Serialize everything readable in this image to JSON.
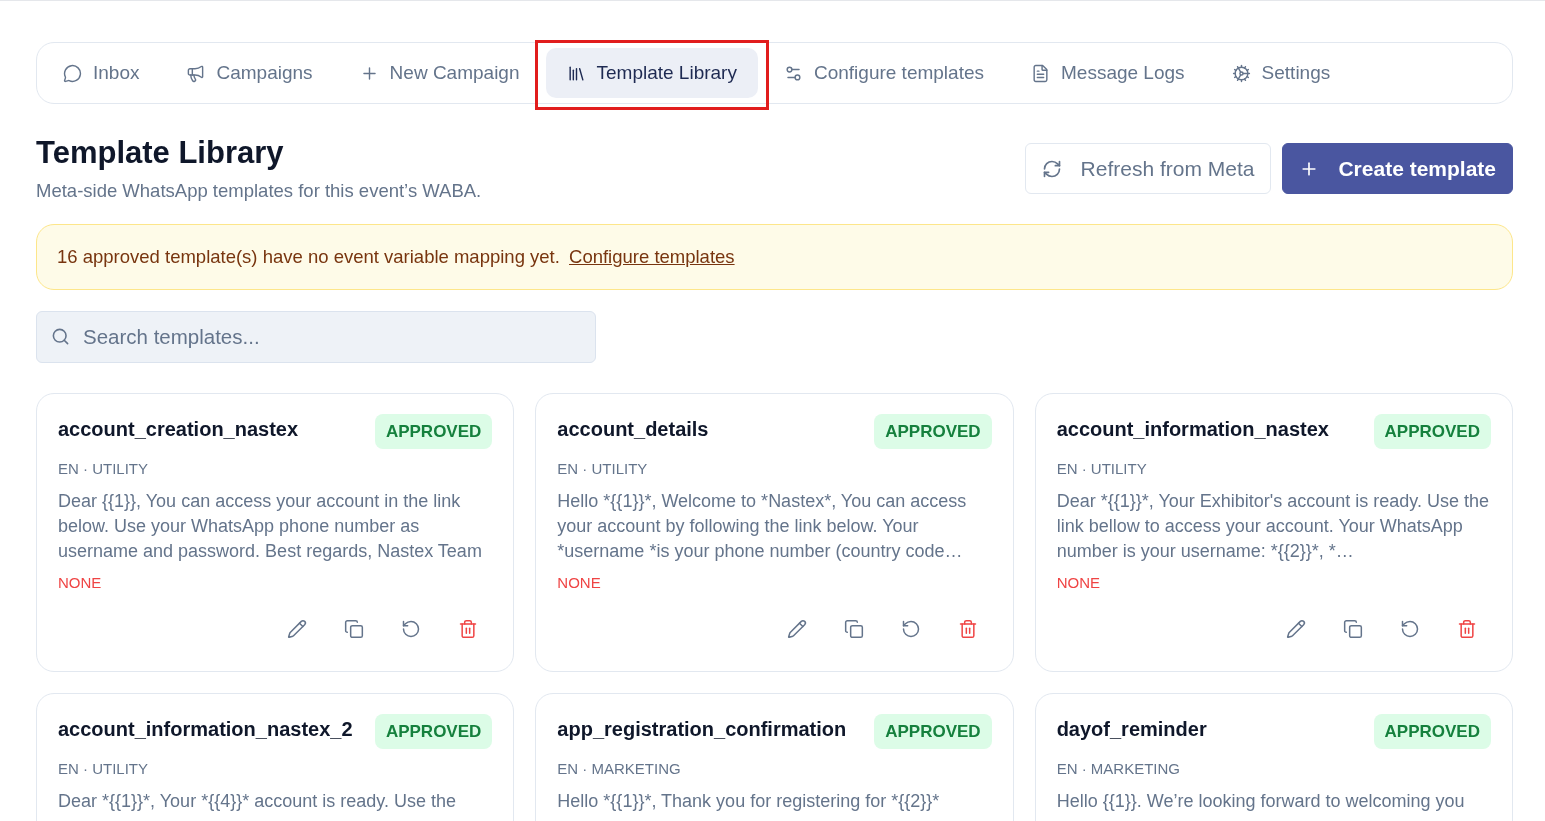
{
  "nav": {
    "tabs": [
      {
        "label": "Inbox",
        "selected": false,
        "highlighted": false
      },
      {
        "label": "Campaigns",
        "selected": false,
        "highlighted": false
      },
      {
        "label": "New Campaign",
        "selected": false,
        "highlighted": false
      },
      {
        "label": "Template Library",
        "selected": true,
        "highlighted": true
      },
      {
        "label": "Configure templates",
        "selected": false,
        "highlighted": false
      },
      {
        "label": "Message Logs",
        "selected": false,
        "highlighted": false
      },
      {
        "label": "Settings",
        "selected": false,
        "highlighted": false
      }
    ]
  },
  "header": {
    "title": "Template Library",
    "subtitle": "Meta-side WhatsApp templates for this event’s WABA.",
    "buttons": [
      {
        "label": "Refresh from Meta",
        "kind": "secondary"
      },
      {
        "label": "Create template",
        "kind": "primary"
      }
    ]
  },
  "notice": {
    "text": "16 approved template(s) have no event variable mapping yet.",
    "link": "Configure templates"
  },
  "search": {
    "placeholder": "Search templates..."
  },
  "templates": [
    {
      "name": "account_creation_nastex",
      "status": {
        "label": "APPROVED",
        "kind": "approved"
      },
      "meta": "EN · UTILITY",
      "body": "Dear {{1}}, You can access your account in the link below. Use your WhatsApp phone number as username and password. Best regards, Nastex Team",
      "mapping": {
        "label": "NONE",
        "kind": "none"
      }
    },
    {
      "name": "account_details",
      "status": {
        "label": "APPROVED",
        "kind": "approved"
      },
      "meta": "EN · UTILITY",
      "body": "Hello *{{1}}*, Welcome to *Nastex*, You can access your account by following the link below. Your *username *is your phone number (country code…",
      "mapping": {
        "label": "NONE",
        "kind": "none"
      }
    },
    {
      "name": "account_information_nastex",
      "status": {
        "label": "APPROVED",
        "kind": "approved"
      },
      "meta": "EN · UTILITY",
      "body": "Dear *{{1}}*, Your Exhibitor's account is ready. Use the link bellow to access your account. Your WhatsApp number is your username: *{{2}}*, *…",
      "mapping": {
        "label": "NONE",
        "kind": "none"
      }
    },
    {
      "name": "account_information_nastex_2",
      "status": {
        "label": "APPROVED",
        "kind": "approved"
      },
      "meta": "EN · UTILITY",
      "body": "Dear *{{1}}*, Your *{{4}}* account is ready. Use the"
    },
    {
      "name": "app_registration_confirmation",
      "status": {
        "label": "APPROVED",
        "kind": "approved"
      },
      "meta": "EN · MARKETING",
      "body": "Hello *{{1}}*, Thank you for registering for *{{2}}*"
    },
    {
      "name": "dayof_reminder",
      "status": {
        "label": "APPROVED",
        "kind": "approved"
      },
      "meta": "EN · MARKETING",
      "body": "Hello {{1}}. We’re looking forward to welcoming you"
    }
  ]
}
